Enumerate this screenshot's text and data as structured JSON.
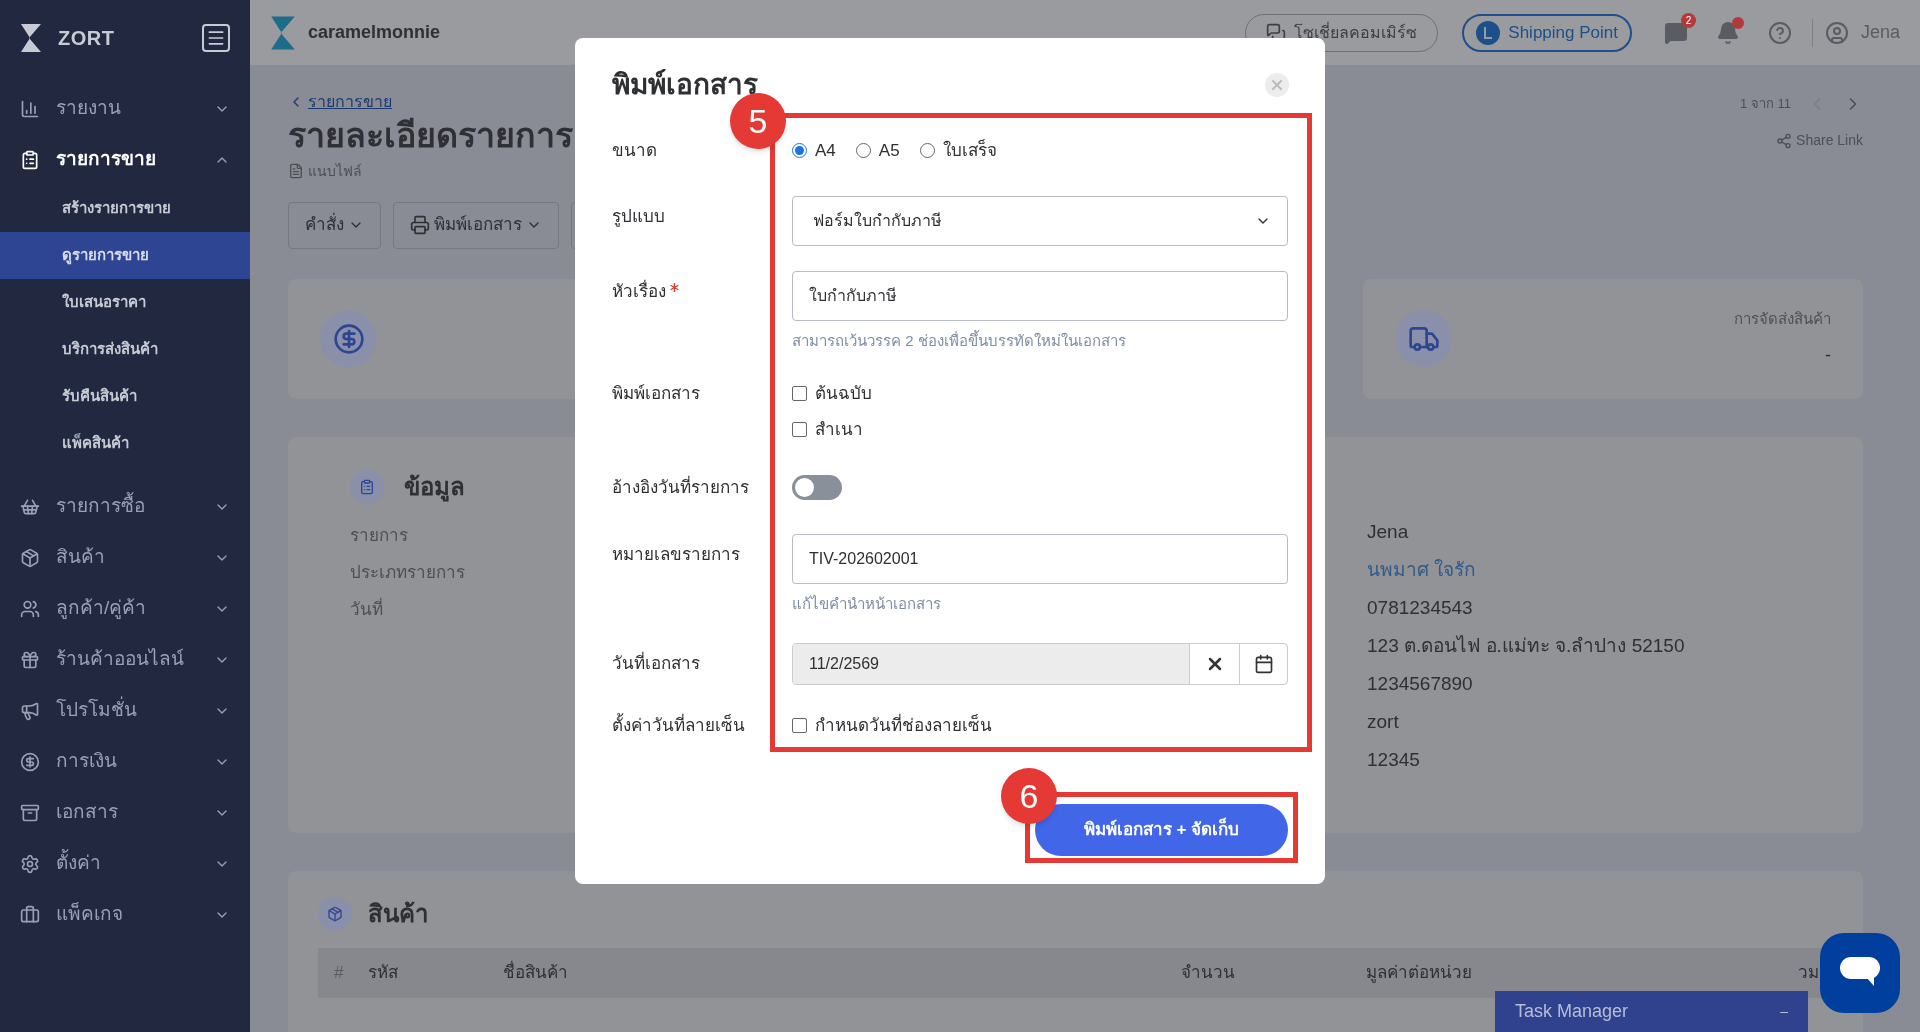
{
  "sidebar": {
    "logo": "ZORT",
    "items": [
      {
        "label": "รายงาน",
        "expanded": false
      },
      {
        "label": "รายการขาย",
        "expanded": true,
        "children": [
          {
            "label": "สร้างรายการขาย",
            "selected": false
          },
          {
            "label": "ดูรายการขาย",
            "selected": true
          },
          {
            "label": "ใบเสนอราคา",
            "selected": false
          },
          {
            "label": "บริการส่งสินค้า",
            "selected": false
          },
          {
            "label": "รับคืนสินค้า",
            "selected": false
          },
          {
            "label": "แพ็คสินค้า",
            "selected": false
          }
        ]
      },
      {
        "label": "รายการซื้อ",
        "expanded": false
      },
      {
        "label": "สินค้า",
        "expanded": false
      },
      {
        "label": "ลูกค้า/คู่ค้า",
        "expanded": false
      },
      {
        "label": "ร้านค้าออนไลน์",
        "expanded": false
      },
      {
        "label": "โปรโมชั่น",
        "expanded": false
      },
      {
        "label": "การเงิน",
        "expanded": false
      },
      {
        "label": "เอกสาร",
        "expanded": false
      },
      {
        "label": "ตั้งค่า",
        "expanded": false
      },
      {
        "label": "แพ็คเกจ",
        "expanded": false
      }
    ]
  },
  "topbar": {
    "store": "caramelmonnie",
    "social": "โซเชี่ยลคอมเมิร์ซ",
    "shipping_point": "Shipping Point",
    "chat_badge": "2",
    "user": "Jena"
  },
  "page": {
    "breadcrumb": "รายการขาย",
    "title": "รายละเอียดรายการ",
    "attach": "แนบไฟล์",
    "pager": "1 จาก 11",
    "share": "Share Link",
    "actions": [
      "คำสั่ง",
      "พิมพ์เอกสาร"
    ],
    "shipping": {
      "label": "การจัดส่งสินค้า",
      "value": "-"
    },
    "info": {
      "title": "ข้อมูล",
      "labels": [
        "รายการ",
        "ประเภทรายการ",
        "วันที่"
      ],
      "values": [
        {
          "text": "Jena",
          "kind": "plain"
        },
        {
          "text": "นพมาศ ใจรัก",
          "kind": "link"
        },
        {
          "text": "0781234543",
          "kind": "plain"
        },
        {
          "text": "123 ต.ดอนไฟ อ.แม่ทะ จ.ลำปาง 52150",
          "kind": "plain"
        },
        {
          "text": "1234567890",
          "kind": "plain"
        },
        {
          "text": "zort",
          "kind": "plain"
        },
        {
          "text": "12345",
          "kind": "plain"
        }
      ]
    },
    "products": {
      "title": "สินค้า",
      "columns": [
        "#",
        "รหัส",
        "ชื่อสินค้า",
        "จำนวน",
        "มูลค่าต่อหน่วย",
        "วม"
      ]
    }
  },
  "task_manager": {
    "title": "Task Manager",
    "minimize": "–"
  },
  "modal": {
    "title": "พิมพ์เอกสาร",
    "rows": [
      {
        "kind": "radio",
        "label": "ขนาด",
        "options": [
          {
            "label": "A4",
            "selected": true
          },
          {
            "label": "A5",
            "selected": false
          },
          {
            "label": "ใบเสร็จ",
            "selected": false
          }
        ]
      },
      {
        "kind": "select",
        "label": "รูปแบบ",
        "value": "ฟอร์มใบกำกับภาษี"
      },
      {
        "kind": "text",
        "label": "หัวเรื่อง",
        "required": true,
        "value": "ใบกำกับภาษี",
        "hint": "สามารถเว้นวรรค 2 ช่องเพื่อขึ้นบรรทัดใหม่ในเอกสาร"
      },
      {
        "kind": "checks",
        "label": "พิมพ์เอกสาร",
        "options": [
          {
            "label": "ต้นฉบับ",
            "checked": false
          },
          {
            "label": "สำเนา",
            "checked": false
          }
        ]
      },
      {
        "kind": "toggle",
        "label": "อ้างอิงวันที่รายการ",
        "on": false
      },
      {
        "kind": "text",
        "label": "หมายเลขรายการ",
        "required": false,
        "value": "TIV-202602001",
        "hint": "แก้ไขคำนำหน้าเอกสาร"
      },
      {
        "kind": "date",
        "label": "วันที่เอกสาร",
        "value": "11/2/2569"
      },
      {
        "kind": "check",
        "label": "ตั้งค่าวันที่ลายเซ็น",
        "option": {
          "label": "กำหนดวันที่ช่องลายเซ็น",
          "checked": false
        }
      }
    ],
    "submit": "พิมพ์เอกสาร + จัดเก็บ"
  },
  "annotations": [
    "5",
    "6"
  ]
}
